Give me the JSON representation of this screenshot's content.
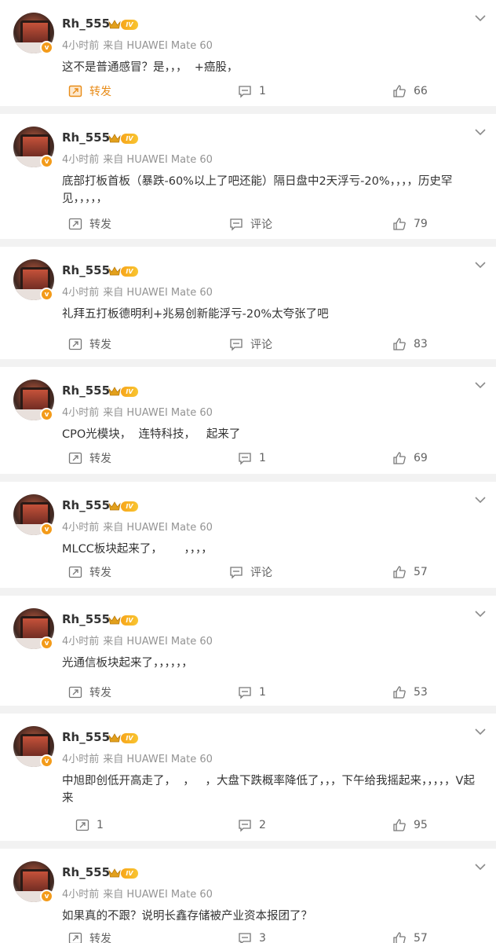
{
  "posts": [
    {
      "user": "Rh_555",
      "time": "4小时前",
      "source": "来自 HUAWEI Mate 60",
      "text": "这不是普通感冒？是，，，  +癌股，",
      "repost": "转发",
      "comment": "1",
      "like": "66",
      "repost_active": true
    },
    {
      "user": "Rh_555",
      "time": "4小时前",
      "source": "来自 HUAWEI Mate 60",
      "text": "底部打板首板（暴跌-60%以上了吧还能）隔日盘中2天浮亏-20%，，，，历史罕见，，，，，",
      "repost": "转发",
      "comment": "评论",
      "like": "79"
    },
    {
      "user": "Rh_555",
      "time": "4小时前",
      "source": "来自 HUAWEI Mate 60",
      "text": "礼拜五打板德明利+兆易创新能浮亏-20%太夸张了吧",
      "repost": "转发",
      "comment": "评论",
      "like": "83"
    },
    {
      "user": "Rh_555",
      "time": "4小时前",
      "source": "来自 HUAWEI Mate 60",
      "text": "CPO光模块，  连特科技，   起来了",
      "repost": "转发",
      "comment": "1",
      "like": "69"
    },
    {
      "user": "Rh_555",
      "time": "4小时前",
      "source": "来自 HUAWEI Mate 60",
      "text": "MLCC板块起来了，      ，，，，",
      "repost": "转发",
      "comment": "评论",
      "like": "57"
    },
    {
      "user": "Rh_555",
      "time": "4小时前",
      "source": "来自 HUAWEI Mate 60",
      "text": "光通信板块起来了，，，，，，",
      "repost": "转发",
      "comment": "1",
      "like": "53"
    },
    {
      "user": "Rh_555",
      "time": "4小时前",
      "source": "来自 HUAWEI Mate 60",
      "text": "中旭即创低开高走了，  ，   ，大盘下跌概率降低了，，，下午给我摇起来，，，，，V起来",
      "repost": "1",
      "comment": "2",
      "like": "95"
    },
    {
      "user": "Rh_555",
      "time": "4小时前",
      "source": "来自 HUAWEI Mate 60",
      "text": "如果真的不跟？说明长鑫存储被产业资本报团了？",
      "repost": "转发",
      "comment": "3",
      "like": "57"
    }
  ],
  "badges": {
    "verified": "v",
    "level": "IV"
  },
  "colors": {
    "repost_highlight": "#e88b17",
    "level_badge": "#f7a51b",
    "meta": "#939393"
  }
}
